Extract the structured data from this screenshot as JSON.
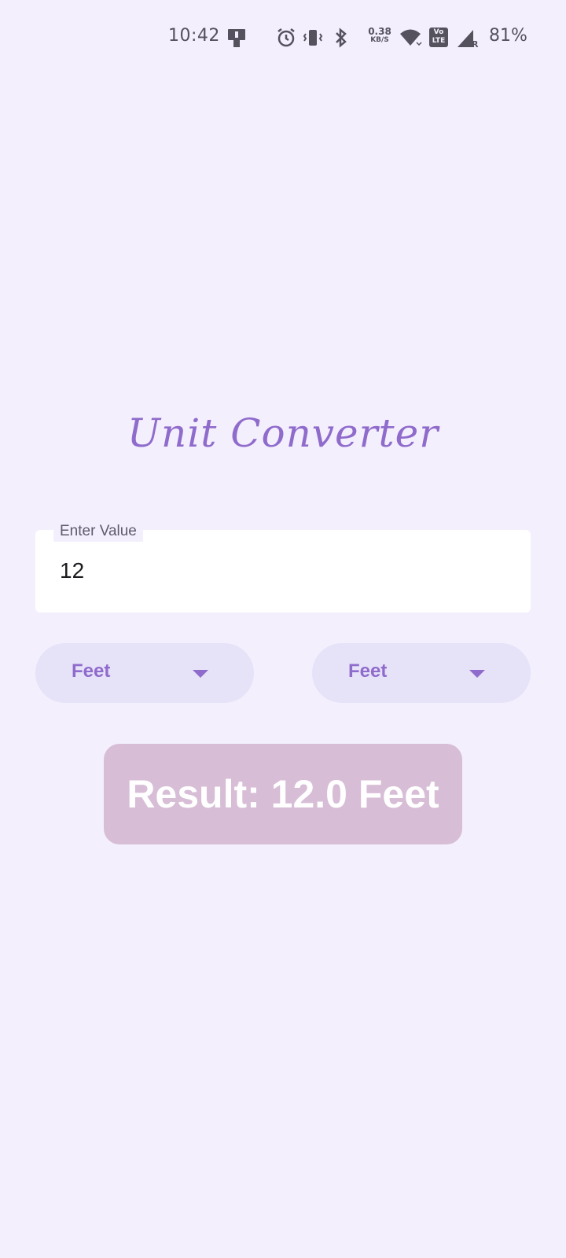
{
  "status_bar": {
    "time": "10:42",
    "net_speed_value": "0.38",
    "net_speed_unit": "KB/S",
    "volte_top": "Vo",
    "volte_bottom": "LTE",
    "signal_tag": "R",
    "battery": "81%",
    "icons": [
      "screen-cast-icon",
      "alarm-icon",
      "vibrate-icon",
      "bluetooth-icon",
      "wifi-icon",
      "signal-icon"
    ]
  },
  "app": {
    "title": "Unit Converter",
    "input": {
      "label": "Enter Value",
      "value": "12"
    },
    "from_unit": "Feet",
    "to_unit": "Feet",
    "result": "Result: 12.0 Feet"
  },
  "colors": {
    "background": "#f3effd",
    "accent": "#8f6bcc",
    "dropdown_bg": "#e6e2f8",
    "result_bg": "#d7bdd6"
  }
}
